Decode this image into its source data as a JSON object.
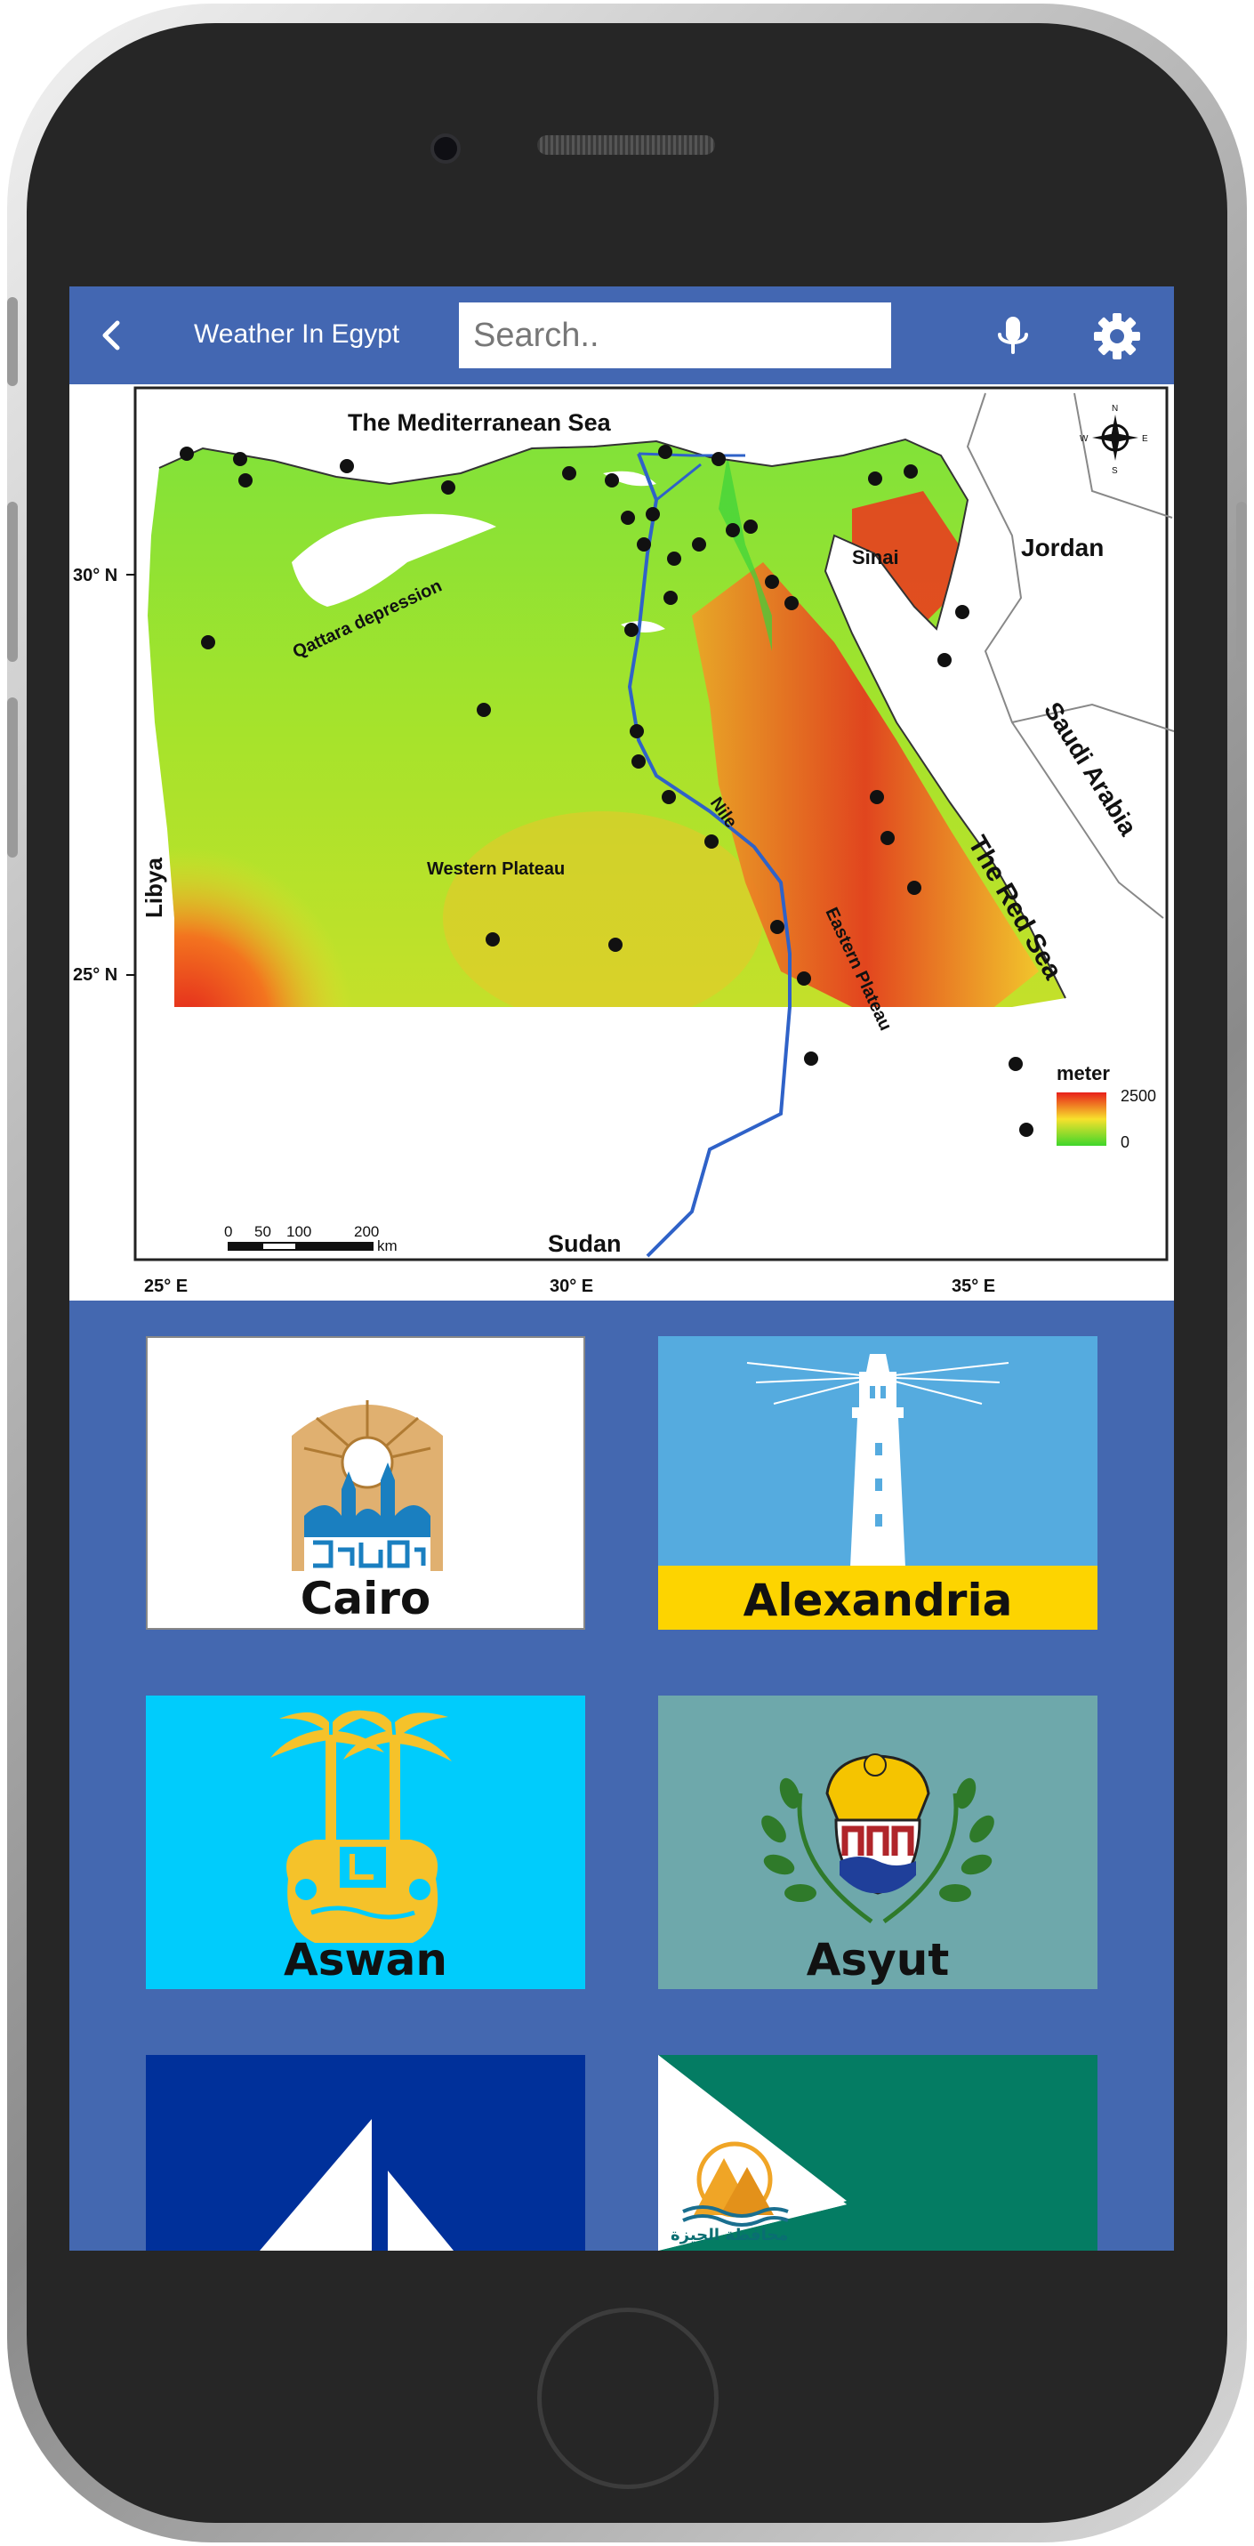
{
  "header": {
    "title": "Weather In Egypt",
    "search_placeholder": "Search..",
    "back_icon": "chevron-left-icon",
    "mic_icon": "microphone-icon",
    "settings_icon": "gear-icon"
  },
  "map": {
    "sea_label": "The Mediterranean Sea",
    "libya": "Libya",
    "sudan": "Sudan",
    "jordan": "Jordan",
    "saudi": "Saudi Arabia",
    "red_sea": "The Red Sea",
    "sinai": "Sinai",
    "qattara": "Qattara depression",
    "western_plateau": "Western Plateau",
    "eastern_plateau": "Eastern Plateau",
    "nile": "Nile",
    "lat_30": "30° N",
    "lat_25": "25° N",
    "lon_25": "25° E",
    "lon_30": "30° E",
    "lon_35": "35° E",
    "scale_0": "0",
    "scale_50": "50",
    "scale_100": "100",
    "scale_200": "200",
    "scale_unit": "km",
    "legend_title": "meter",
    "legend_max": "2500",
    "legend_min": "0",
    "compass_n": "N",
    "compass_s": "S",
    "compass_e": "E",
    "compass_w": "W"
  },
  "cities": [
    {
      "name": "Cairo",
      "bg": "#ffffff",
      "label_bg": "#ffffff"
    },
    {
      "name": "Alexandria",
      "bg": "#55abdf",
      "label_bg": "#fdd400"
    },
    {
      "name": "Aswan",
      "bg": "#00ccfc",
      "label_bg": "#00ccfc"
    },
    {
      "name": "Asyut",
      "bg": "#6ea8ab",
      "label_bg": "#6ea8ab"
    },
    {
      "name": "",
      "bg": "#00309a",
      "label_bg": "#00309a"
    },
    {
      "name": "",
      "bg": "#047c63",
      "label_bg": "#047c63"
    }
  ],
  "giza_logo_text": "محافظة الجيزة"
}
